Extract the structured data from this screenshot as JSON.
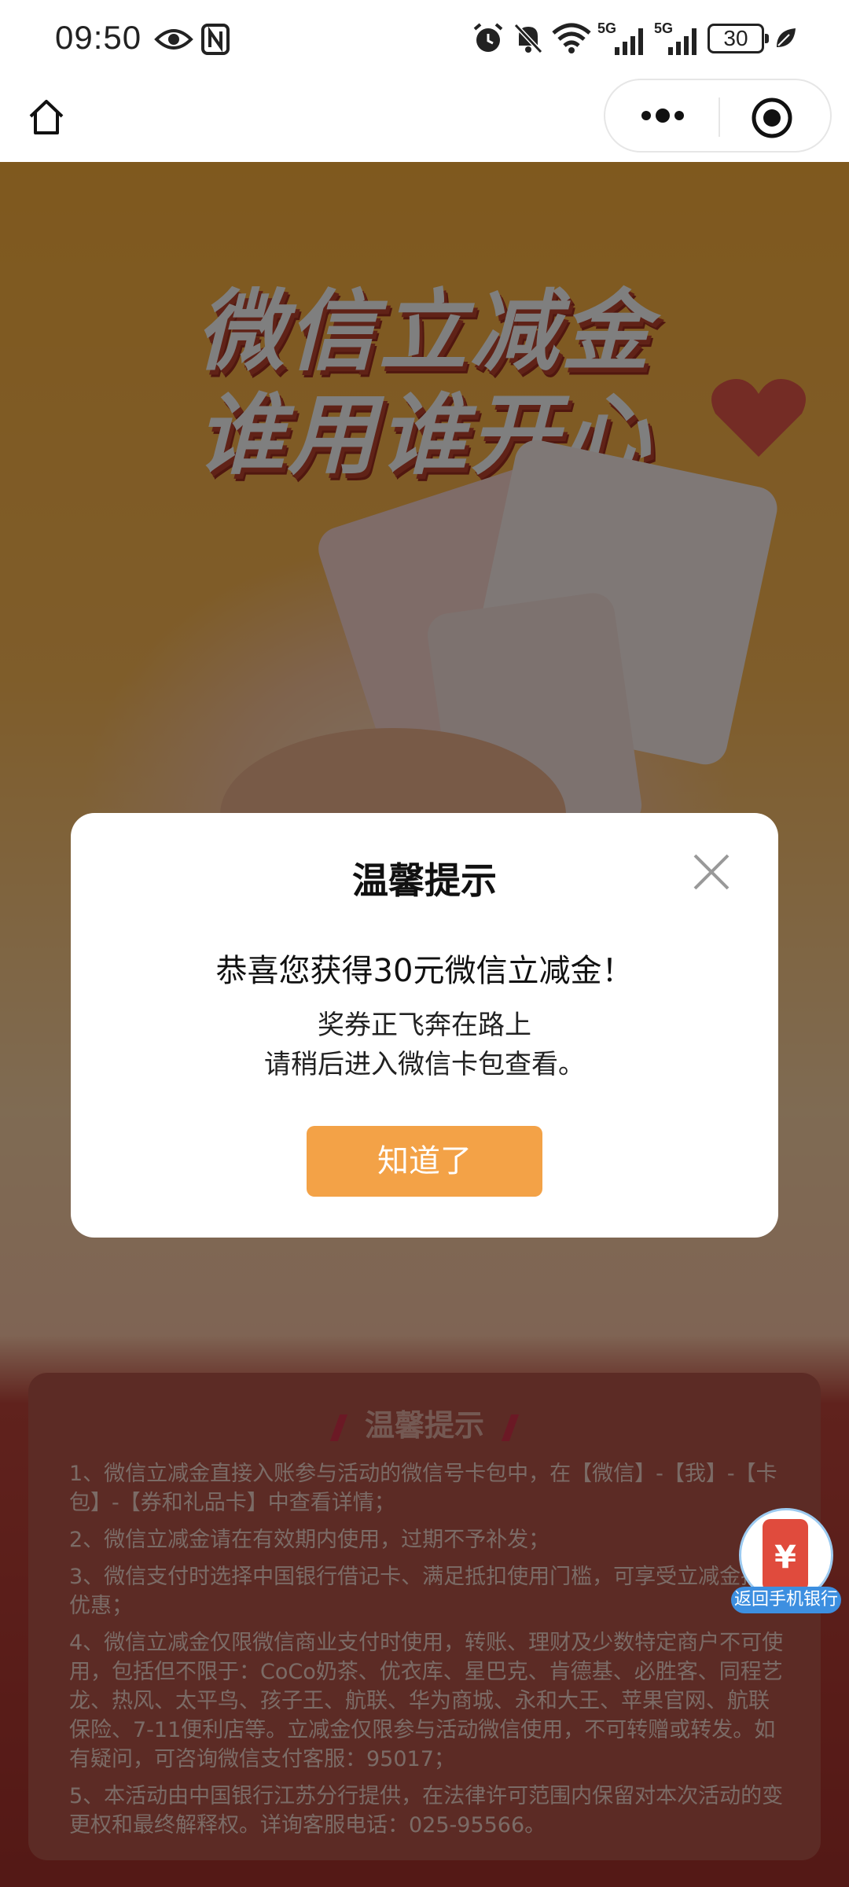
{
  "status_bar": {
    "time": "09:50",
    "battery": "30",
    "icons": [
      "eye-icon",
      "nfc-icon",
      "alarm-icon",
      "mute-icon",
      "wifi-icon",
      "signal-5g-icon",
      "signal-5g-icon",
      "leaf-icon"
    ],
    "signal_labels": [
      "5G",
      "5G"
    ]
  },
  "nav": {
    "home_icon": "home-icon",
    "more_icon": "more-dots-icon",
    "close_icon": "target-circle-icon"
  },
  "hero": {
    "line1": "微信立减金",
    "line2": "谁用谁开心"
  },
  "info": {
    "title": "温馨提示",
    "rules": [
      "1、微信立减金直接入账参与活动的微信号卡包中，在【微信】-【我】-【卡包】-【券和礼品卡】中查看详情；",
      "2、微信立减金请在有效期内使用，过期不予补发；",
      "3、微信支付时选择中国银行借记卡、满足抵扣使用门槛，可享受立减金抵扣优惠；",
      "4、微信立减金仅限微信商业支付时使用，转账、理财及少数特定商户不可使用，包括但不限于：CoCo奶茶、优衣库、星巴克、肯德基、必胜客、同程艺龙、热风、太平鸟、孩子王、航联、华为商城、永和大王、苹果官网、航联保险、7-11便利店等。立减金仅限参与活动微信使用，不可转赠或转发。如有疑问，可咨询微信支付客服：95017；",
      "5、本活动由中国银行江苏分行提供，在法律许可范围内保留对本次活动的变更权和最终解释权。详询客服电话：025-95566。"
    ]
  },
  "float_badge": {
    "symbol": "¥",
    "label": "返回手机银行"
  },
  "dialog": {
    "title": "温馨提示",
    "main": "恭喜您获得30元微信立减金！",
    "sub1": "奖券正飞奔在路上",
    "sub2": "请稍后进入微信卡包查看。",
    "button": "知道了"
  },
  "colors": {
    "accent": "#f3a247",
    "page_top": "#ffb23d",
    "page_bottom": "#a8322c",
    "badge_blue": "#3d8fe0"
  }
}
